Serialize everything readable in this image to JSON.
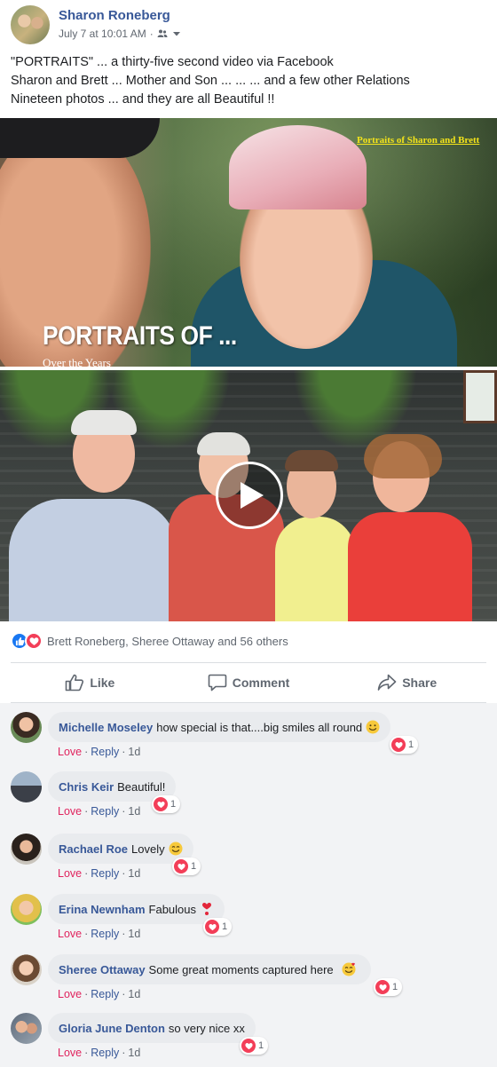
{
  "post": {
    "author": "Sharon Roneberg",
    "timestamp": "July 7 at 10:01 AM",
    "audience_icon": "friends-icon",
    "text_lines": [
      "\"PORTRAITS\" ... a thirty-five second video via Facebook",
      "Sharon and Brett ... Mother and Son ... ... ... and a few other Relations",
      "Nineteen photos ... and they are all Beautiful !!"
    ]
  },
  "media": {
    "overlay_title": "Portraits of Sharon and Brett",
    "caption": "PORTRAITS OF ...",
    "subcaption": "Over the Years"
  },
  "reactions": {
    "summary": "Brett Roneberg, Sheree Ottaway and 56 others",
    "icons": [
      "like-icon",
      "love-icon"
    ]
  },
  "actions": {
    "like": "Like",
    "comment": "Comment",
    "share": "Share"
  },
  "comments": [
    {
      "author": "Michelle Moseley",
      "text": "how special is that....big smiles all round",
      "emoji": "smile",
      "love": "Love",
      "reply": "Reply",
      "age": "1d",
      "reactions": "1"
    },
    {
      "author": "Chris Keir",
      "text": "Beautiful!",
      "emoji": "",
      "love": "Love",
      "reply": "Reply",
      "age": "1d",
      "reactions": "1"
    },
    {
      "author": "Rachael Roe",
      "text": "Lovely",
      "emoji": "smile",
      "love": "Love",
      "reply": "Reply",
      "age": "1d",
      "reactions": "1"
    },
    {
      "author": "Erina Newnham",
      "text": "Fabulous",
      "emoji": "heart-exclamation",
      "love": "Love",
      "reply": "Reply",
      "age": "1d",
      "reactions": "1"
    },
    {
      "author": "Sheree Ottaway",
      "text": "Some great moments captured here",
      "emoji": "hearts-face",
      "love": "Love",
      "reply": "Reply",
      "age": "1d",
      "reactions": "1"
    },
    {
      "author": "Gloria June Denton",
      "text": "so very nice xx",
      "emoji": "",
      "love": "Love",
      "reply": "Reply",
      "age": "1d",
      "reactions": "1"
    }
  ],
  "colors": {
    "link": "#385898",
    "love": "#f33e58",
    "like": "#1877f2"
  }
}
